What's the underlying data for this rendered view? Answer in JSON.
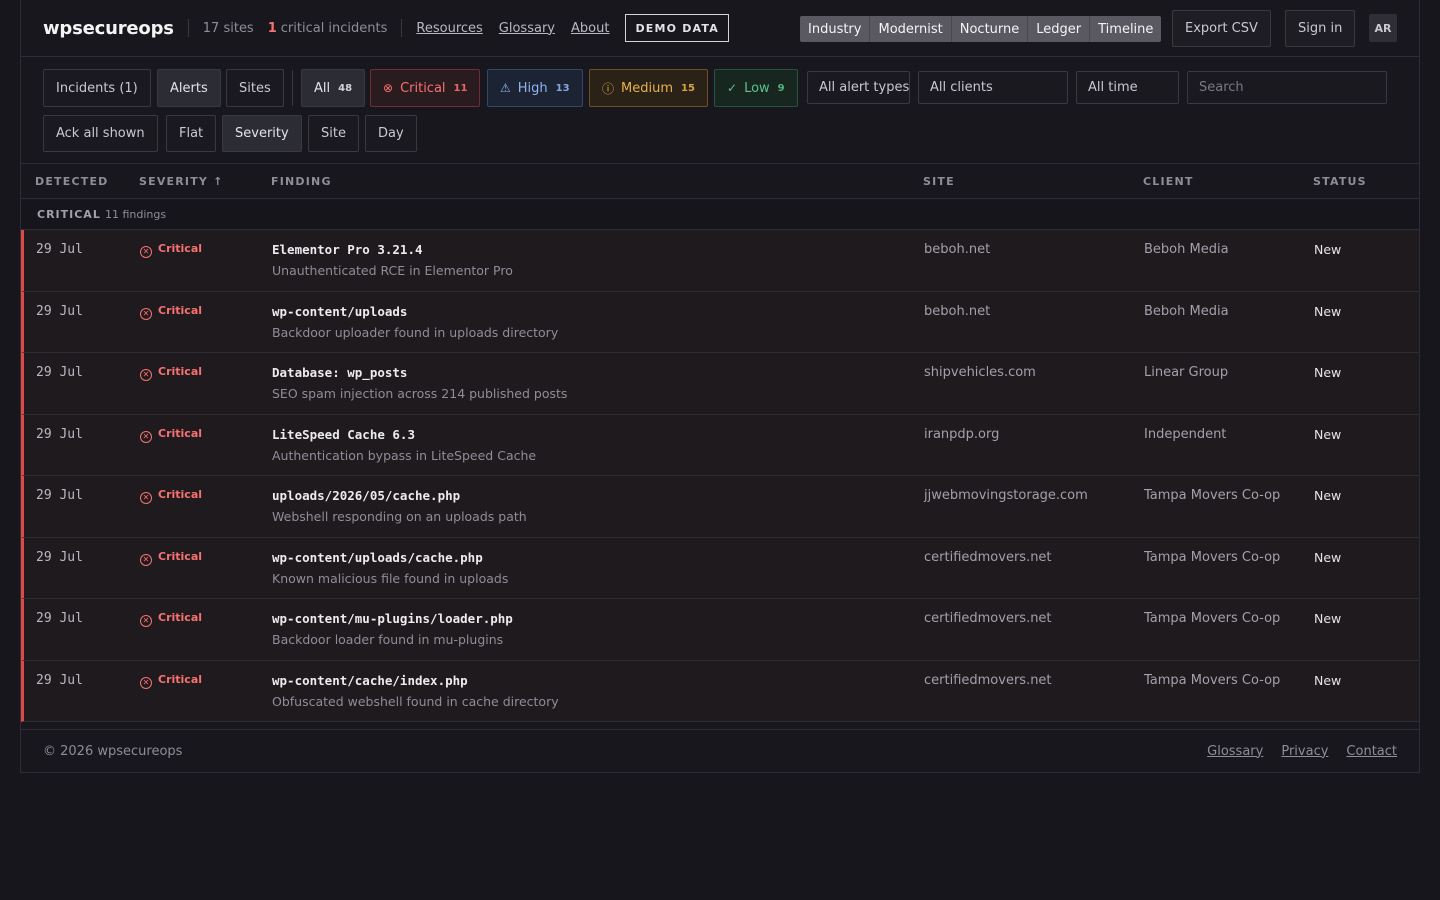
{
  "header": {
    "brand": "wpsecureops",
    "sites": "17 sites",
    "critical_num": "1",
    "critical_label": "critical incidents",
    "nav": [
      "Resources",
      "Glossary",
      "About"
    ],
    "demo_badge": "DEMO DATA",
    "themes": [
      "Industry",
      "Modernist",
      "Nocturne",
      "Ledger",
      "Timeline"
    ],
    "export_label": "Export CSV",
    "signin_label": "Sign in",
    "avatar": "AR"
  },
  "toolbar": {
    "views": [
      "Incidents (1)",
      "Alerts",
      "Sites"
    ],
    "filters": {
      "all": {
        "label": "All",
        "count": "48"
      },
      "critical": {
        "label": "Critical",
        "count": "11"
      },
      "high": {
        "label": "High",
        "count": "13"
      },
      "medium": {
        "label": "Medium",
        "count": "15"
      },
      "low": {
        "label": "Low",
        "count": "9"
      }
    },
    "alert_types": "All alert types",
    "clients": "All clients",
    "time": "All time",
    "search_placeholder": "Search",
    "ack_label": "Ack all shown",
    "groupings": [
      "Flat",
      "Severity",
      "Site",
      "Day"
    ]
  },
  "table": {
    "columns": [
      "DETECTED",
      "SEVERITY ↑",
      "FINDING",
      "SITE",
      "CLIENT",
      "STATUS"
    ],
    "group": {
      "name": "CRITICAL",
      "count": "11 findings"
    },
    "rows": [
      {
        "date": "29 Jul",
        "severity": "Critical",
        "title": "Elementor Pro 3.21.4",
        "desc": "Unauthenticated RCE in Elementor Pro",
        "site": "beboh.net",
        "client": "Beboh Media",
        "status": "New"
      },
      {
        "date": "29 Jul",
        "severity": "Critical",
        "title": "wp-content/uploads",
        "desc": "Backdoor uploader found in uploads directory",
        "site": "beboh.net",
        "client": "Beboh Media",
        "status": "New"
      },
      {
        "date": "29 Jul",
        "severity": "Critical",
        "title": "Database: wp_posts",
        "desc": "SEO spam injection across 214 published posts",
        "site": "shipvehicles.com",
        "client": "Linear Group",
        "status": "New"
      },
      {
        "date": "29 Jul",
        "severity": "Critical",
        "title": "LiteSpeed Cache 6.3",
        "desc": "Authentication bypass in LiteSpeed Cache",
        "site": "iranpdp.org",
        "client": "Independent",
        "status": "New"
      },
      {
        "date": "29 Jul",
        "severity": "Critical",
        "title": "uploads/2026/05/cache.php",
        "desc": "Webshell responding on an uploads path",
        "site": "jjwebmovingstorage.com",
        "client": "Tampa Movers Co-op",
        "status": "New"
      },
      {
        "date": "29 Jul",
        "severity": "Critical",
        "title": "wp-content/uploads/cache.php",
        "desc": "Known malicious file found in uploads",
        "site": "certifiedmovers.net",
        "client": "Tampa Movers Co-op",
        "status": "New"
      },
      {
        "date": "29 Jul",
        "severity": "Critical",
        "title": "wp-content/mu-plugins/loader.php",
        "desc": "Backdoor loader found in mu-plugins",
        "site": "certifiedmovers.net",
        "client": "Tampa Movers Co-op",
        "status": "New"
      },
      {
        "date": "29 Jul",
        "severity": "Critical",
        "title": "wp-content/cache/index.php",
        "desc": "Obfuscated webshell found in cache directory",
        "site": "certifiedmovers.net",
        "client": "Tampa Movers Co-op",
        "status": "New"
      }
    ]
  },
  "footer": {
    "copyright": "© 2026 wpsecureops",
    "links": [
      "Glossary",
      "Privacy",
      "Contact"
    ]
  },
  "colors": {
    "critical": "#f87171",
    "critical_bar": "#e04848",
    "high": "#8fb4f5",
    "medium": "#e8b04a",
    "low": "#5cc08f"
  }
}
